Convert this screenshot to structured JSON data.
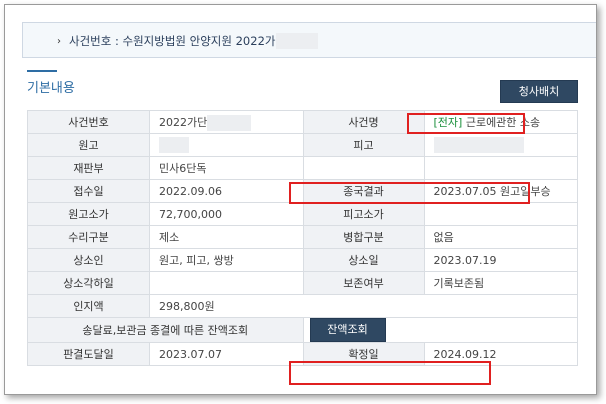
{
  "case_header": {
    "bullet": "›",
    "text": "사건번호 : 수원지방법원 안양지원 2022가단"
  },
  "section": {
    "title": "기본내용",
    "print_button": "청사배치"
  },
  "rows": [
    {
      "k1": "사건번호",
      "v1": "2022가단",
      "k2": "사건명",
      "v2_tag": "[전자]",
      "v2": " 근로에관한 소송"
    },
    {
      "k1": "원고",
      "v1": "",
      "k2": "피고",
      "v2": ""
    },
    {
      "k1": "재판부",
      "v1": "민사6단독",
      "k2": "",
      "v2": ""
    },
    {
      "k1": "접수일",
      "v1": "2022.09.06",
      "k2": "종국결과",
      "v2": "2023.07.05 원고일부승"
    },
    {
      "k1": "원고소가",
      "v1": "72,700,000",
      "k2": "피고소가",
      "v2": ""
    },
    {
      "k1": "수리구분",
      "v1": "제소",
      "k2": "병합구분",
      "v2": "없음"
    },
    {
      "k1": "상소인",
      "v1": "원고, 피고, 쌍방",
      "k2": "상소일",
      "v2": "2023.07.19"
    },
    {
      "k1": "상소각하일",
      "v1": "",
      "k2": "보존여부",
      "v2": "기록보존됨"
    },
    {
      "k1": "인지액",
      "v1": "298,800원",
      "k2": "",
      "v2": ""
    }
  ],
  "balance_row": {
    "label": "송달료,보관금 종결에 따른 잔액조회",
    "button": "잔액조회"
  },
  "last_row": {
    "k1": "판결도달일",
    "v1": "2023.07.07",
    "k2": "확정일",
    "v2": "2024.09.12"
  },
  "colors": {
    "accent": "#2e6da4",
    "button": "#2f4862",
    "highlight": "#e02020",
    "tag": "#1a8f3c"
  }
}
